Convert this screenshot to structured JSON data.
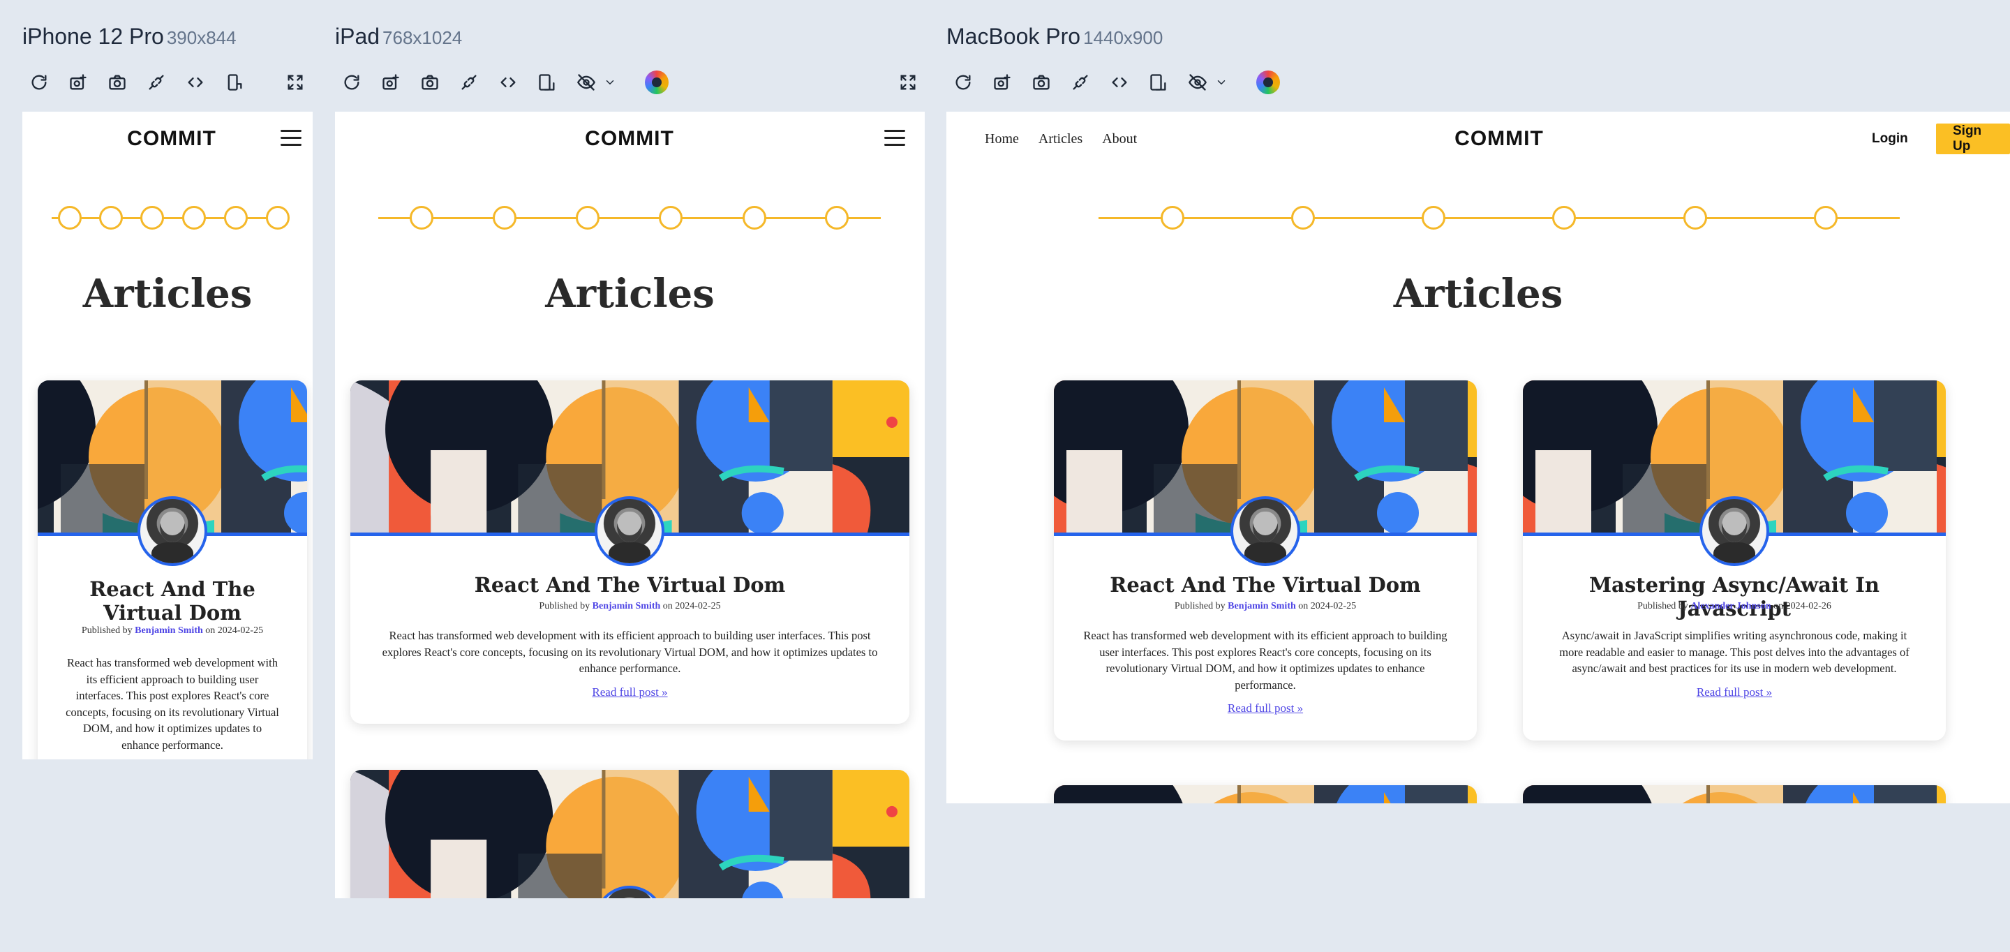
{
  "devices": [
    {
      "name": "iPhone 12 Pro",
      "dims": "390x844"
    },
    {
      "name": "iPad",
      "dims": "768x1024"
    },
    {
      "name": "MacBook Pro",
      "dims": "1440x900"
    }
  ],
  "toolbar_icons": [
    "refresh-icon",
    "screenshot-icon",
    "camera-icon",
    "disconnect-icon",
    "code-icon",
    "rotate-device-icon",
    "hide-icon",
    "chevron-down-icon",
    "color-picker-icon",
    "fullscreen-icon"
  ],
  "site": {
    "logo": "COMMIT",
    "nav": {
      "home": "Home",
      "articles": "Articles",
      "about": "About"
    },
    "login": "Login",
    "signup": "Sign Up",
    "heading": "Articles",
    "accent_color": "#fbbf24",
    "link_color": "#4f46e5",
    "avatar_ring_color": "#2563eb"
  },
  "articles": [
    {
      "title": "React And The Virtual Dom",
      "published_prefix": "Published by",
      "author": "Benjamin Smith",
      "on": "on",
      "date": "2024-02-25",
      "excerpt": "React has transformed web development with its efficient approach to building user interfaces. This post explores React's core concepts, focusing on its revolutionary Virtual DOM, and how it optimizes updates to enhance performance.",
      "read_more": "Read full post"
    },
    {
      "title": "Mastering Async/Await In Javascript",
      "published_prefix": "Published by",
      "author": "Alexander Johnson",
      "on": "on",
      "date": "2024-02-26",
      "excerpt": "Async/await in JavaScript simplifies writing asynchronous code, making it more readable and easier to manage. This post delves into the advantages of async/await and best practices for its use in modern web development.",
      "read_more": "Read full post"
    }
  ]
}
